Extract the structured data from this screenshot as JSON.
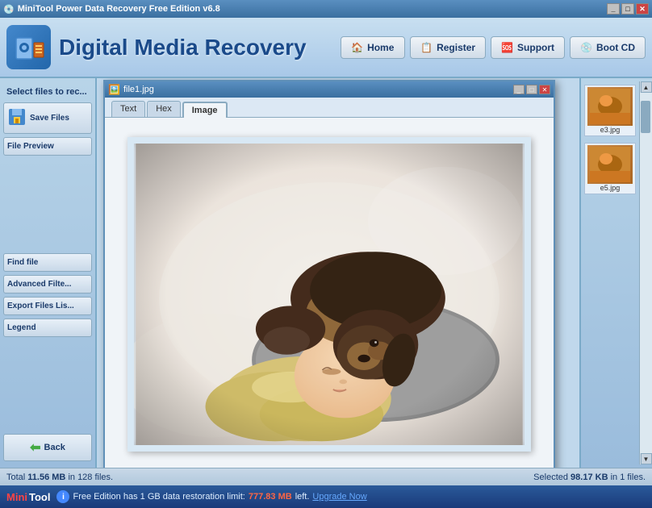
{
  "app": {
    "title": "MiniTool Power Data Recovery Free Edition v6.8",
    "title_icon": "💿"
  },
  "nav": {
    "logo_text": "Digital Media Recovery",
    "buttons": [
      {
        "label": "Home",
        "icon": "🏠",
        "id": "home"
      },
      {
        "label": "Register",
        "icon": "📋",
        "id": "register"
      },
      {
        "label": "Support",
        "icon": "🆘",
        "id": "support"
      },
      {
        "label": "Boot CD",
        "icon": "💿",
        "id": "bootcd"
      }
    ]
  },
  "left_panel": {
    "title": "Select files to rec...",
    "save_files_label": "Save Files",
    "file_preview_label": "File Preview",
    "find_file_label": "Find file",
    "advanced_filter_label": "Advanced Filte...",
    "export_files_label": "Export Files Lis...",
    "legend_label": "Legend",
    "back_label": "Back"
  },
  "popup": {
    "title": "file1.jpg",
    "tabs": [
      "Text",
      "Hex",
      "Image"
    ],
    "active_tab": "Image"
  },
  "right_panel": {
    "items": [
      {
        "label": "e3.jpg",
        "has_thumb": true
      },
      {
        "label": "e5.jpg",
        "has_thumb": true
      }
    ]
  },
  "status": {
    "left_prefix": "Total ",
    "left_bold": "11.56 MB",
    "left_suffix": " in 128 files.",
    "right_prefix": "Selected ",
    "right_bold": "98.17 KB",
    "right_suffix": " in 1 files."
  },
  "bottom": {
    "brand_mini": "Mini",
    "brand_tool": "Tool",
    "message_prefix": "Free Edition has 1 GB data restoration limit: ",
    "highlight": "777.83 MB",
    "message_mid": " left. ",
    "upgrade": "Upgrade Now"
  },
  "title_controls": [
    "_",
    "□",
    "✕"
  ],
  "popup_controls": [
    "_",
    "□",
    "✕"
  ]
}
